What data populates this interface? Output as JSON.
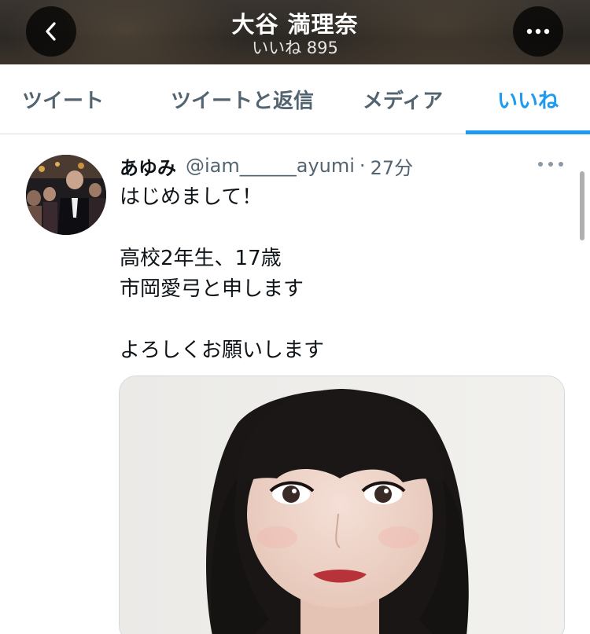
{
  "header": {
    "title": "大谷 満理奈",
    "subtitle": "いいね 895",
    "back_icon": "chevron-left-icon",
    "more_icon": "more-horizontal-icon"
  },
  "tabs": [
    {
      "label": "ツイート",
      "active": false
    },
    {
      "label": "ツイートと返信",
      "active": false
    },
    {
      "label": "メディア",
      "active": false
    },
    {
      "label": "いいね",
      "active": true
    }
  ],
  "accent_color": "#1d9bf0",
  "tweet": {
    "author_name": "あゆみ",
    "author_handle": "@iam______ayumi",
    "separator": "·",
    "time": "27分",
    "lines": [
      "はじめまして！",
      "",
      "高校2年生、17歳",
      "市岡愛弓と申します",
      "",
      "よろしくお願いします"
    ]
  }
}
